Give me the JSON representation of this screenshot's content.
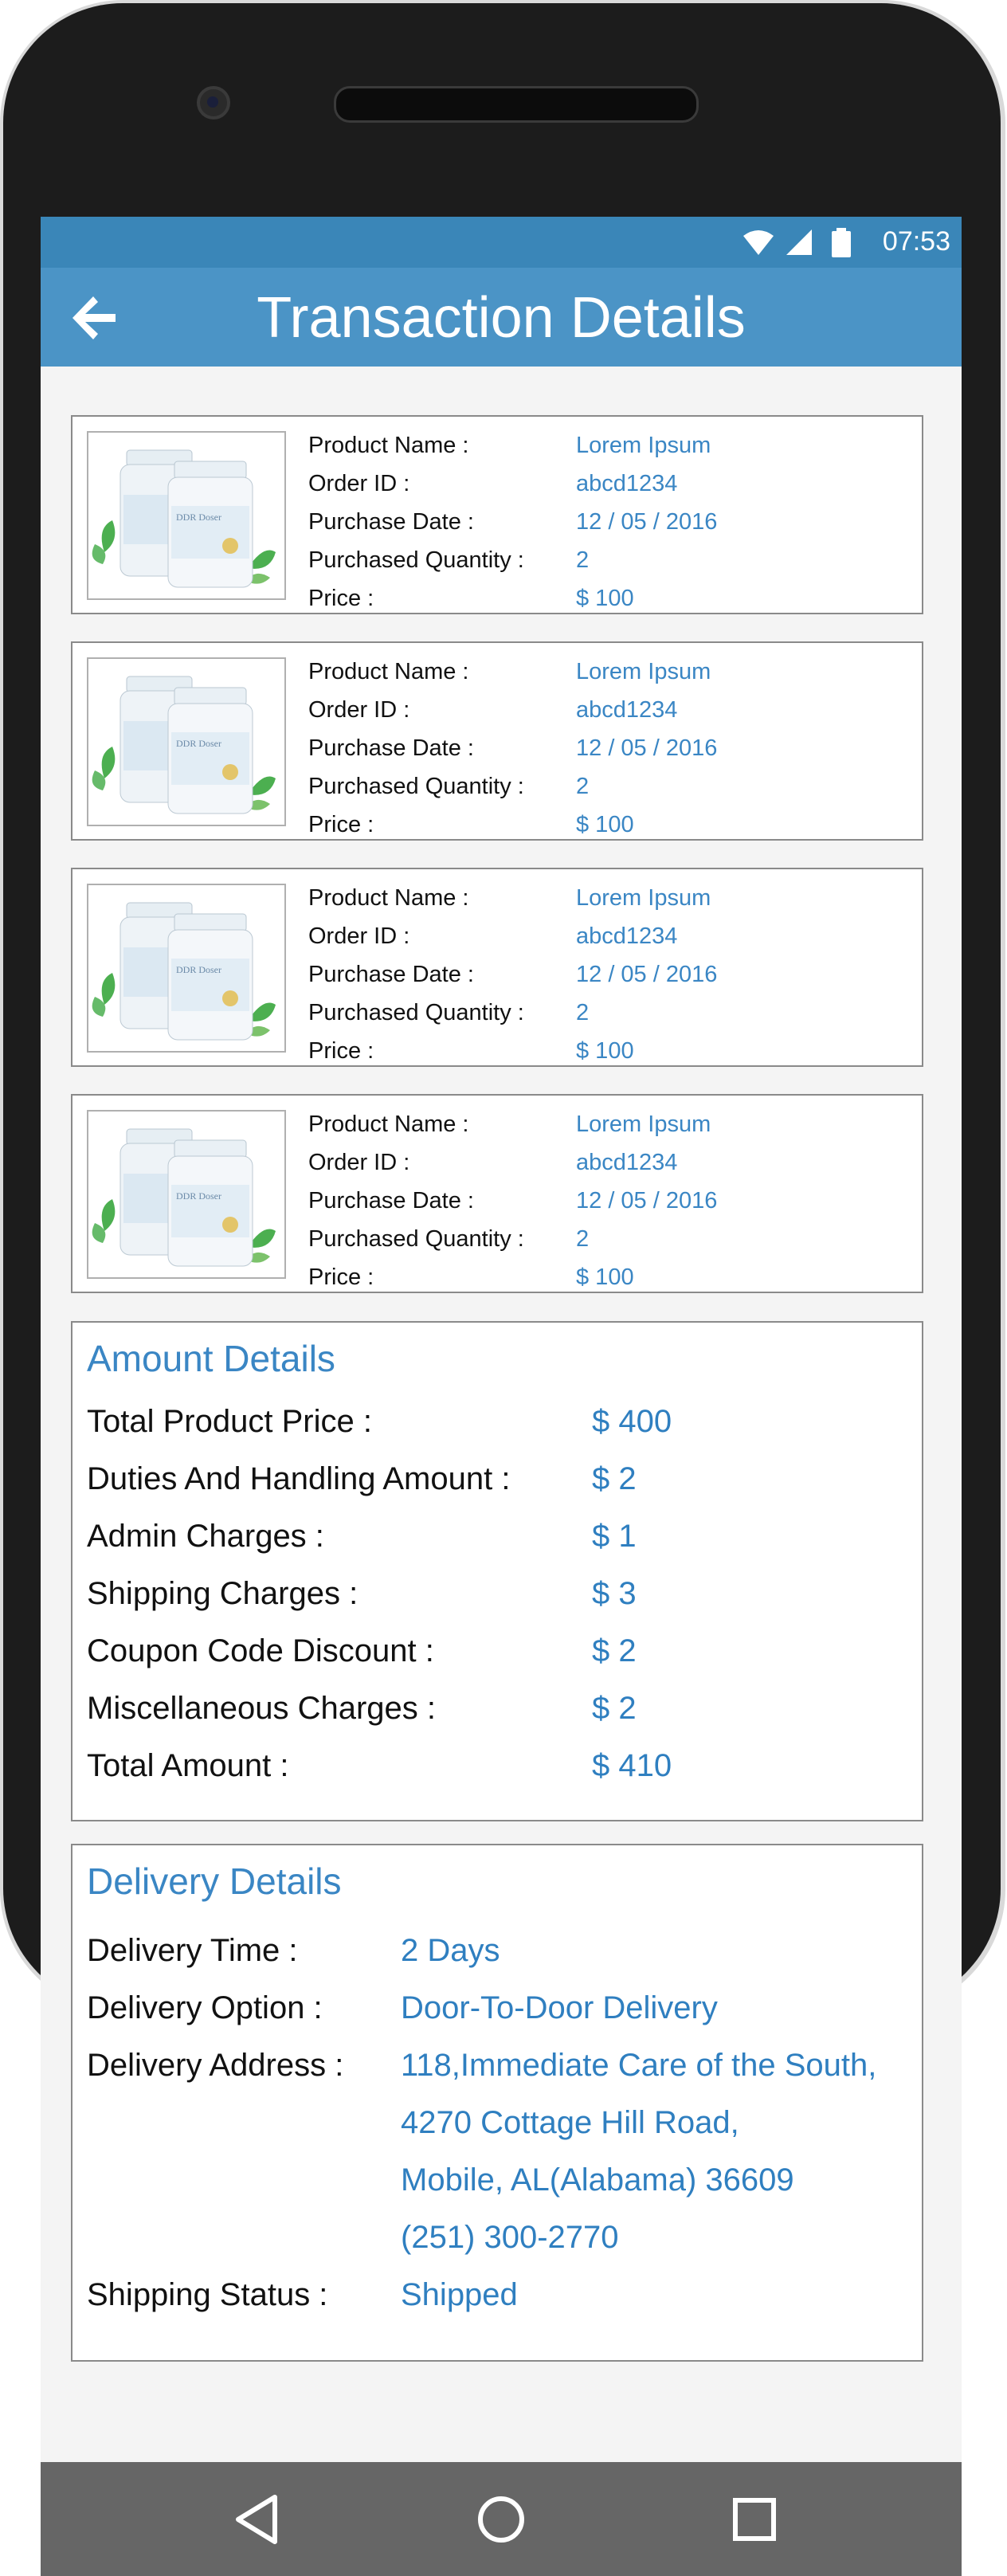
{
  "status": {
    "time": "07:53"
  },
  "header": {
    "title": "Transaction Details"
  },
  "products": [
    {
      "rows": [
        {
          "label": "Product Name :",
          "value": "Lorem Ipsum"
        },
        {
          "label": "Order ID :",
          "value": "abcd1234"
        },
        {
          "label": "Purchase Date :",
          "value": "12 / 05 / 2016"
        },
        {
          "label": "Purchased Quantity :",
          "value": "2"
        },
        {
          "label": "Price :",
          "value": "$ 100"
        }
      ]
    },
    {
      "rows": [
        {
          "label": "Product Name :",
          "value": "Lorem Ipsum"
        },
        {
          "label": "Order ID :",
          "value": "abcd1234"
        },
        {
          "label": "Purchase Date :",
          "value": "12 / 05 / 2016"
        },
        {
          "label": "Purchased Quantity :",
          "value": "2"
        },
        {
          "label": "Price :",
          "value": "$ 100"
        }
      ]
    },
    {
      "rows": [
        {
          "label": "Product Name :",
          "value": "Lorem Ipsum"
        },
        {
          "label": "Order ID :",
          "value": "abcd1234"
        },
        {
          "label": "Purchase Date :",
          "value": "12 / 05 / 2016"
        },
        {
          "label": "Purchased Quantity :",
          "value": "2"
        },
        {
          "label": "Price :",
          "value": "$ 100"
        }
      ]
    },
    {
      "rows": [
        {
          "label": "Product Name :",
          "value": "Lorem Ipsum"
        },
        {
          "label": "Order ID :",
          "value": "abcd1234"
        },
        {
          "label": "Purchase Date :",
          "value": "12 / 05 / 2016"
        },
        {
          "label": "Purchased Quantity :",
          "value": "2"
        },
        {
          "label": "Price :",
          "value": "$ 100"
        }
      ]
    }
  ],
  "amount": {
    "title": "Amount Details",
    "rows": [
      {
        "label": "Total Product Price :",
        "value": "$ 400"
      },
      {
        "label": "Duties And Handling Amount :",
        "value": "$ 2"
      },
      {
        "label": "Admin Charges :",
        "value": "$ 1"
      },
      {
        "label": "Shipping Charges :",
        "value": "$ 3"
      },
      {
        "label": "Coupon Code Discount :",
        "value": "$ 2"
      },
      {
        "label": "Miscellaneous Charges :",
        "value": "$ 2"
      },
      {
        "label": "Total Amount :",
        "value": "$ 410"
      }
    ]
  },
  "delivery": {
    "title": "Delivery Details",
    "time_label": "Delivery Time :",
    "time_value": "2 Days",
    "option_label": "Delivery Option :",
    "option_value": "Door-To-Door Delivery",
    "address_label": "Delivery Address :",
    "address_lines": [
      "118,Immediate Care of the South,",
      "4270 Cottage Hill Road,",
      "Mobile, AL(Alabama) 36609",
      "(251) 300-2770"
    ],
    "status_label": "Shipping Status :",
    "status_value": "Shipped"
  },
  "icons": {
    "back": "back-arrow-icon",
    "product": "supplement-bottles-image",
    "nav_back": "nav-back-icon",
    "nav_home": "nav-home-icon",
    "nav_recents": "nav-recents-icon"
  },
  "colors": {
    "appbar": "#4b94c6",
    "statusbar": "#3a86b8",
    "accent_text": "#3a86c4"
  }
}
